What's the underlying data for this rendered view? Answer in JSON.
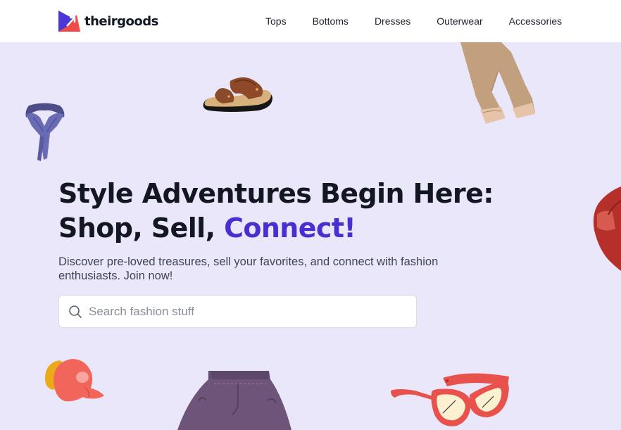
{
  "brand": {
    "name": "theirgoods",
    "colors": {
      "blue": "#4a37d6",
      "red": "#ef4b48"
    }
  },
  "nav": {
    "items": [
      "Tops",
      "Bottoms",
      "Dresses",
      "Outerwear",
      "Accessories"
    ]
  },
  "hero": {
    "headline_line1": "Style Adventures Begin Here:",
    "headline_line2_prefix": "Shop, Sell, ",
    "headline_accent": "Connect!",
    "accent_color": "#4a2ed0",
    "background": "#ebe7fb",
    "subtitle": "Discover pre-loved treasures, sell your favorites, and connect with fashion enthusiasts. Join now!"
  },
  "search": {
    "placeholder": "Search fashion stuff",
    "value": "",
    "icon": "search-icon"
  },
  "illustrations": [
    "scarf",
    "sandal",
    "trousers",
    "red-jacket",
    "cap",
    "shorts",
    "sunglasses"
  ]
}
